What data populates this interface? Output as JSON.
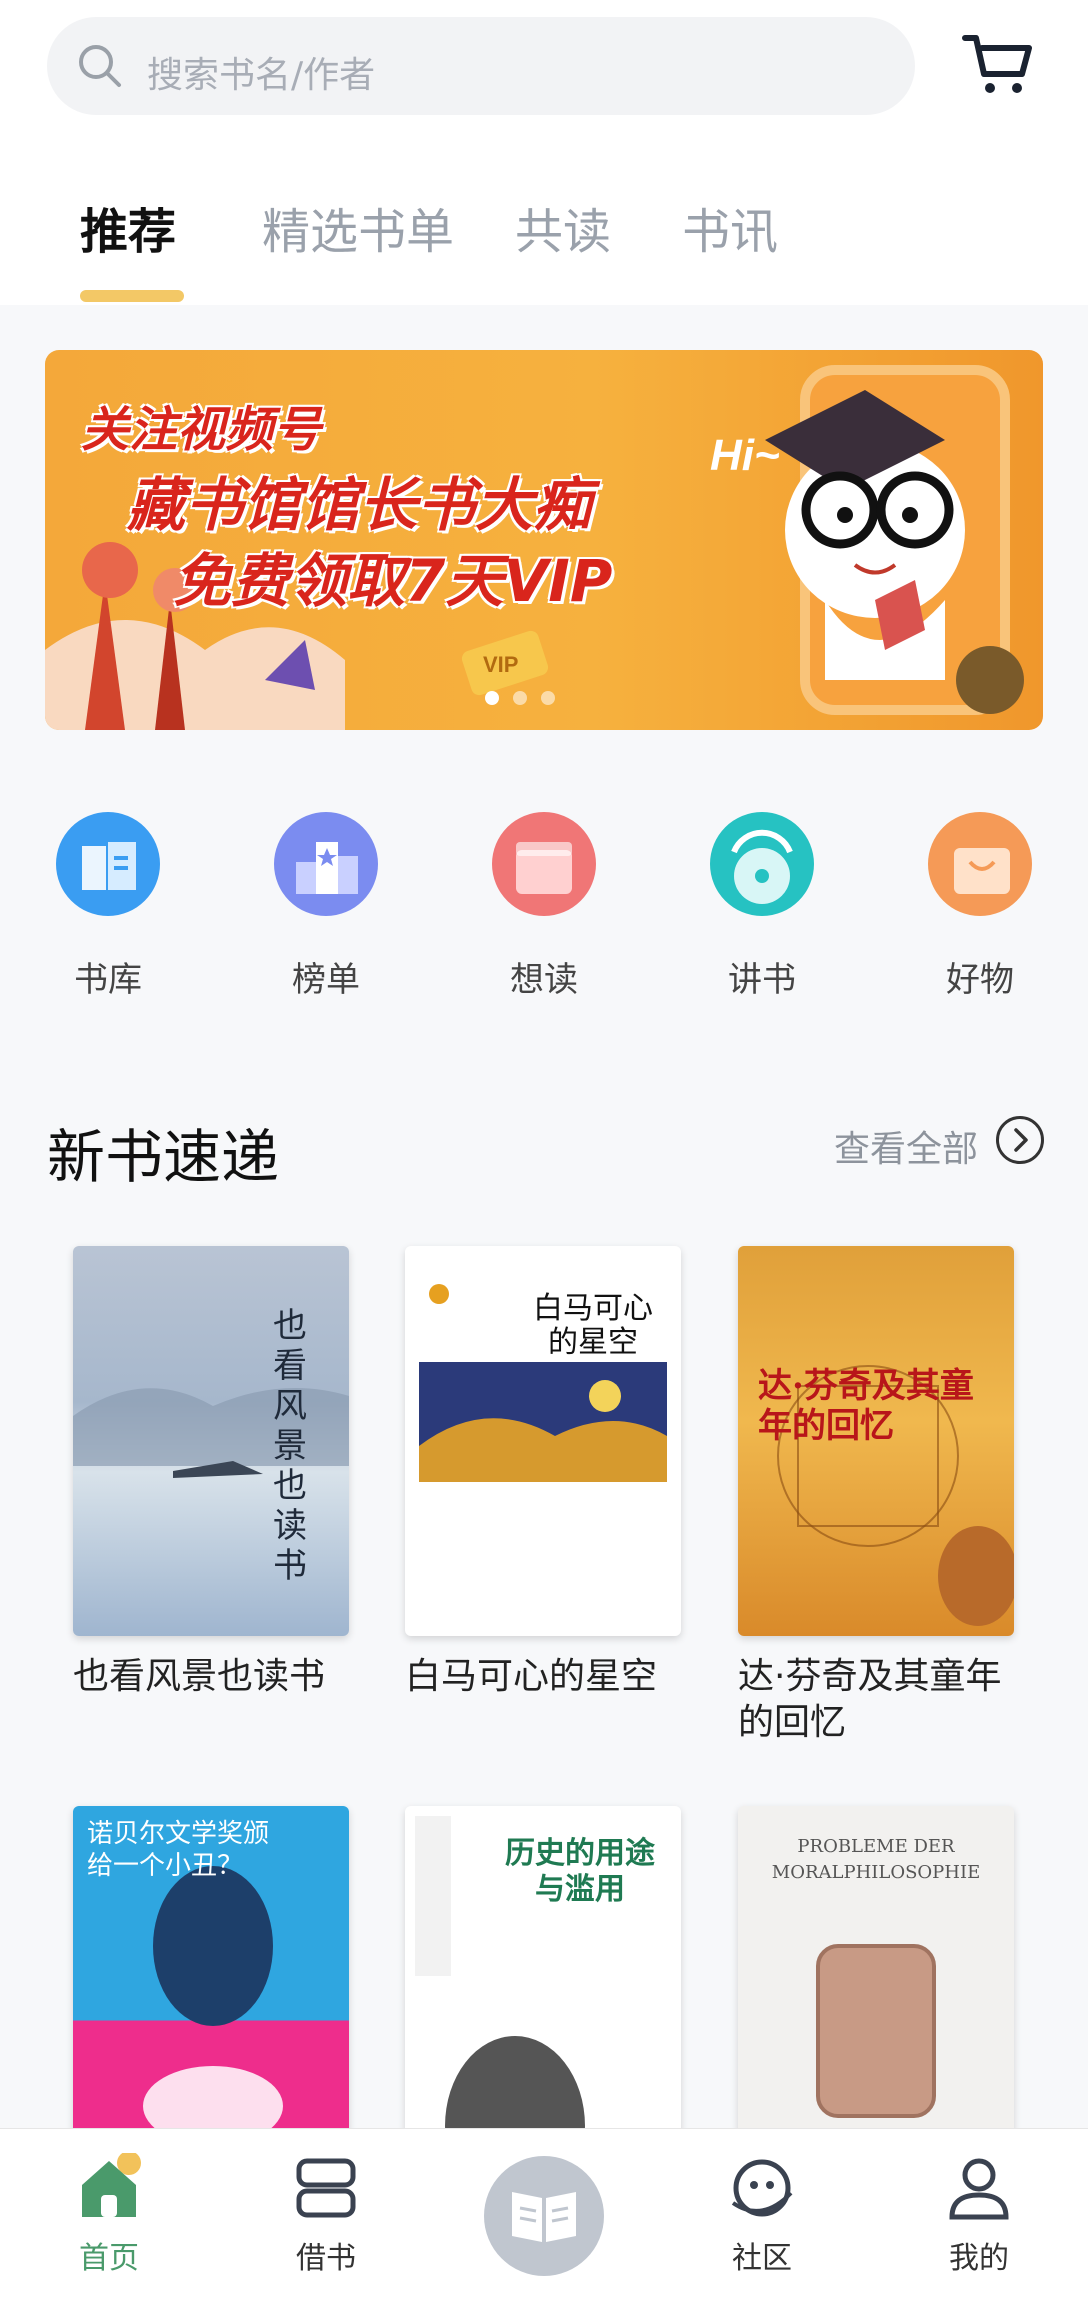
{
  "search": {
    "placeholder": "搜索书名/作者"
  },
  "tabs": [
    {
      "label": "推荐",
      "active": true
    },
    {
      "label": "精选书单",
      "active": false
    },
    {
      "label": "共读",
      "active": false
    },
    {
      "label": "书讯",
      "active": false
    }
  ],
  "banner": {
    "line1": "关注视频号",
    "line2": "藏书馆馆长书大痴",
    "line3": "免费领取7天VIP",
    "badge": "VIP",
    "hi": "Hi~"
  },
  "quick_links": [
    {
      "label": "书库",
      "color": "#3a9df2",
      "icon": "library-icon"
    },
    {
      "label": "榜单",
      "color": "#7b8cf0",
      "icon": "ranking-icon"
    },
    {
      "label": "想读",
      "color": "#f07676",
      "icon": "wishlist-icon"
    },
    {
      "label": "讲书",
      "color": "#26c2c2",
      "icon": "audio-book-icon"
    },
    {
      "label": "好物",
      "color": "#f59a57",
      "icon": "shopping-bag-icon"
    }
  ],
  "new_books": {
    "title": "新书速递",
    "view_all": "查看全部",
    "items": [
      {
        "title": "也看风景也读书",
        "cover_text": "也看风景也读书"
      },
      {
        "title": "白马可心的星空",
        "cover_text": "白马可心的星空"
      },
      {
        "title": "达·芬奇及其童年的回忆",
        "cover_text": "达·芬奇及其童年的回忆"
      },
      {
        "title": "",
        "cover_text": "诺贝尔文学奖颁给一个小丑？"
      },
      {
        "title": "",
        "cover_text": "历史的用途与滥用"
      },
      {
        "title": "",
        "cover_text": "PROBLEME DER MORALPHILOSOPHIE"
      }
    ]
  },
  "bottom_nav": [
    {
      "label": "首页",
      "active": true
    },
    {
      "label": "借书",
      "active": false
    },
    {
      "label": "社区",
      "active": false
    },
    {
      "label": "我的",
      "active": false
    }
  ],
  "colors": {
    "accent_tab": "#f3c866",
    "nav_active": "#4a9a6b"
  }
}
